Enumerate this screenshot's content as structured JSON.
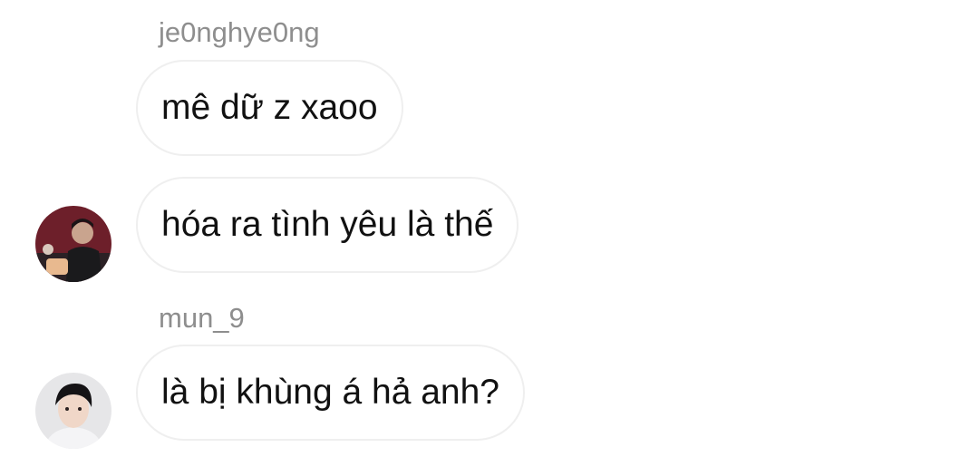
{
  "messages": [
    {
      "sender": "je0nghye0ng",
      "text": "mê dữ z xaoo",
      "avatar": null
    },
    {
      "sender": null,
      "text": "hóa ra tình yêu là thế",
      "avatar": "user-photo-avatar"
    },
    {
      "sender": "mun_9",
      "text": "là bị khùng á hả anh?",
      "avatar": "user-photo-avatar"
    }
  ],
  "colors": {
    "sender_text": "#8e8e8e",
    "bubble_border": "#efefef",
    "message_text": "#111111"
  }
}
